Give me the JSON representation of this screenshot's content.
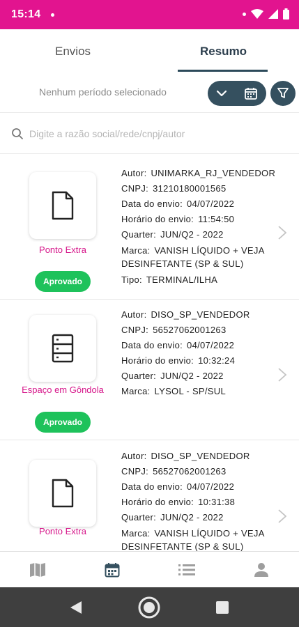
{
  "status_bar": {
    "time": "15:14",
    "color": "#e2148f"
  },
  "tabs": [
    {
      "label": "Envios",
      "active": false
    },
    {
      "label": "Resumo",
      "active": true
    }
  ],
  "period": {
    "label": "Nenhum período selecionado"
  },
  "search": {
    "placeholder": "Digite a razão social/rede/cnpj/autor",
    "value": ""
  },
  "cards": [
    {
      "icon": "document-icon",
      "category": "Ponto Extra",
      "status": "Aprovado",
      "fields": [
        {
          "label": "Autor:",
          "value": "UNIMARKA_RJ_VENDEDOR"
        },
        {
          "label": "CNPJ:",
          "value": "31210180001565"
        },
        {
          "label": "Data do envio:",
          "value": "04/07/2022"
        },
        {
          "label": "Horário do envio:",
          "value": "11:54:50"
        },
        {
          "label": "Quarter:",
          "value": "JUN/Q2 - 2022"
        },
        {
          "label": "Marca:",
          "value": "VANISH LÍQUIDO + VEJA DESINFETANTE (SP & SUL)"
        },
        {
          "label": "Tipo:",
          "value": "TERMINAL/ILHA"
        }
      ]
    },
    {
      "icon": "shelf-icon",
      "category": "Espaço em Gôndola",
      "status": "Aprovado",
      "fields": [
        {
          "label": "Autor:",
          "value": "DISO_SP_VENDEDOR"
        },
        {
          "label": "CNPJ:",
          "value": "56527062001263"
        },
        {
          "label": "Data do envio:",
          "value": "04/07/2022"
        },
        {
          "label": "Horário do envio:",
          "value": "10:32:24"
        },
        {
          "label": "Quarter:",
          "value": "JUN/Q2 - 2022"
        },
        {
          "label": "Marca:",
          "value": "LYSOL - SP/SUL"
        }
      ]
    },
    {
      "icon": "document-icon",
      "category": "Ponto Extra",
      "status": "",
      "fields": [
        {
          "label": "Autor:",
          "value": "DISO_SP_VENDEDOR"
        },
        {
          "label": "CNPJ:",
          "value": "56527062001263"
        },
        {
          "label": "Data do envio:",
          "value": "04/07/2022"
        },
        {
          "label": "Horário do envio:",
          "value": "10:31:38"
        },
        {
          "label": "Quarter:",
          "value": "JUN/Q2 - 2022"
        },
        {
          "label": "Marca:",
          "value": "VANISH LÍQUIDO + VEJA DESINFETANTE (SP & SUL)"
        }
      ]
    }
  ],
  "bottom_nav": [
    {
      "icon": "map-icon",
      "active": false
    },
    {
      "icon": "calendar-icon",
      "active": true
    },
    {
      "icon": "list-icon",
      "active": false
    },
    {
      "icon": "person-icon",
      "active": false
    }
  ],
  "colors": {
    "accent": "#35505f",
    "pink": "#d6168a",
    "success": "#1ec25b"
  }
}
